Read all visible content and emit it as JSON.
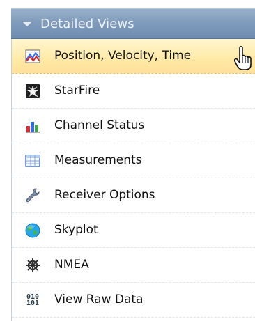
{
  "section": {
    "title": "Detailed Views"
  },
  "items": [
    {
      "label": "Position, Velocity, Time",
      "icon": "line-chart-icon",
      "selected": true
    },
    {
      "label": "StarFire",
      "icon": "starfire-icon",
      "selected": false
    },
    {
      "label": "Channel Status",
      "icon": "bar-chart-icon",
      "selected": false
    },
    {
      "label": "Measurements",
      "icon": "table-icon",
      "selected": false
    },
    {
      "label": "Receiver Options",
      "icon": "wrench-icon",
      "selected": false
    },
    {
      "label": "Skyplot",
      "icon": "globe-icon",
      "selected": false
    },
    {
      "label": "NMEA",
      "icon": "ship-wheel-icon",
      "selected": false
    },
    {
      "label": "View Raw Data",
      "icon": "binary-icon",
      "selected": false
    }
  ],
  "binary_icon_text": {
    "line1": "010",
    "line2": "101"
  },
  "colors": {
    "header": "#7f9abb",
    "selected": "#ffe8a3",
    "text": "#111111"
  }
}
